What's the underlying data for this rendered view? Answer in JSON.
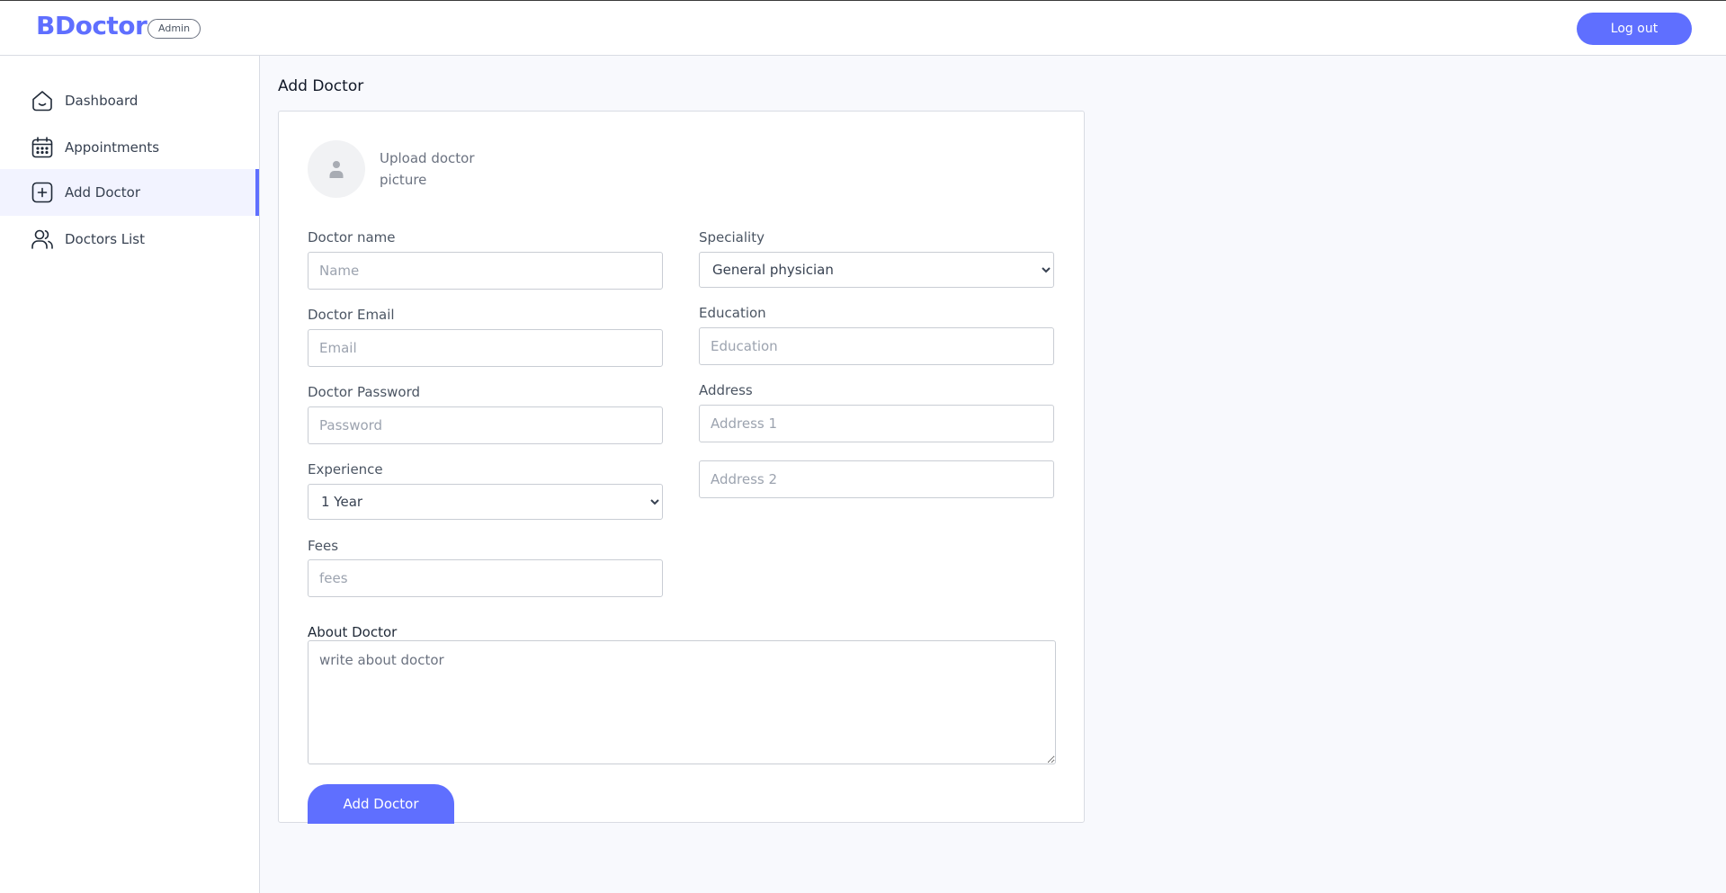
{
  "header": {
    "logo": "BDoctor",
    "role_badge": "Admin",
    "logout_label": "Log out"
  },
  "sidebar": {
    "items": [
      {
        "label": "Dashboard",
        "icon": "home-icon",
        "active": false
      },
      {
        "label": "Appointments",
        "icon": "calendar-icon",
        "active": false
      },
      {
        "label": "Add Doctor",
        "icon": "add-square-icon",
        "active": true
      },
      {
        "label": "Doctors List",
        "icon": "people-icon",
        "active": false
      }
    ]
  },
  "main": {
    "page_title": "Add Doctor",
    "upload": {
      "icon": "user-avatar-icon",
      "text": "Upload doctor picture"
    },
    "form": {
      "doctor_name": {
        "label": "Doctor name",
        "placeholder": "Name"
      },
      "doctor_email": {
        "label": "Doctor Email",
        "placeholder": "Email"
      },
      "doctor_password": {
        "label": "Doctor Password",
        "placeholder": "Password"
      },
      "experience": {
        "label": "Experience",
        "selected": "1 Year"
      },
      "fees": {
        "label": "Fees",
        "placeholder": "fees"
      },
      "speciality": {
        "label": "Speciality",
        "selected": "General physician"
      },
      "education": {
        "label": "Education",
        "placeholder": "Education"
      },
      "address": {
        "label": "Address",
        "placeholder_1": "Address 1",
        "placeholder_2": "Address 2"
      },
      "about": {
        "label": "About Doctor",
        "placeholder": "write about doctor"
      },
      "submit_label": "Add Doctor"
    }
  },
  "colors": {
    "primary": "#5f6fff",
    "active_bg": "#f2f3ff",
    "main_bg": "#f8f9fd",
    "border": "#d9dce3"
  }
}
